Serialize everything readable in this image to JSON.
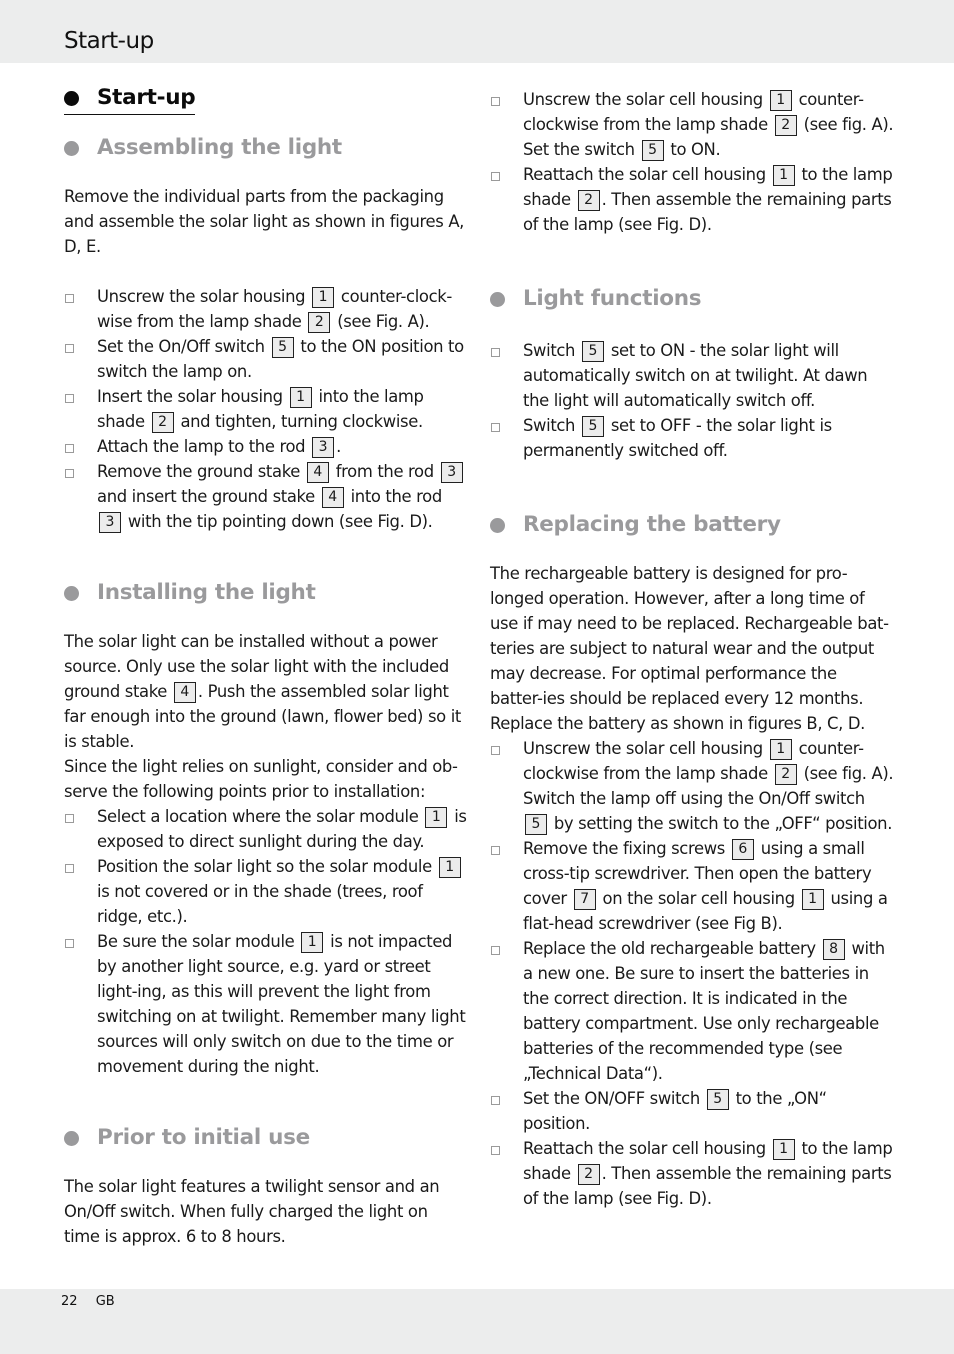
{
  "header": {
    "title": "Start-up"
  },
  "footer": {
    "page_number": "22",
    "language": "GB"
  },
  "main_heading": "Start-up",
  "sections": {
    "assembling": {
      "title": "Assembling the light",
      "intro": "Remove the individual parts from the packaging and assemble the solar light as shown in figures A, D, E.",
      "steps": [
        [
          "Unscrew the solar housing ",
          {
            "ref": "1"
          },
          " counter-clock-wise from the lamp shade ",
          {
            "ref": "2"
          },
          " (see Fig. A)."
        ],
        [
          "Set the On/Off switch ",
          {
            "ref": "5"
          },
          " to the ON position to switch the lamp on."
        ],
        [
          "Insert the solar housing ",
          {
            "ref": "1"
          },
          " into the lamp shade ",
          {
            "ref": "2"
          },
          " and tighten, turning clockwise."
        ],
        [
          "Attach the lamp to the rod ",
          {
            "ref": "3"
          },
          "."
        ],
        [
          "Remove the ground stake ",
          {
            "ref": "4"
          },
          " from the rod ",
          {
            "ref": "3"
          },
          " and insert the ground stake ",
          {
            "ref": "4"
          },
          " into the rod ",
          {
            "ref": "3"
          },
          " with the tip pointing down (see Fig. D)."
        ]
      ]
    },
    "installing": {
      "title": "Installing the light",
      "intro": [
        "The solar light can be installed without a power source. Only use the solar light with the included ground stake ",
        {
          "ref": "4"
        },
        ". Push the assembled solar light far enough into the ground (lawn, flower bed) so it is stable."
      ],
      "intro2": "Since the light relies on sunlight, consider and ob-serve the following points prior to installation:",
      "steps": [
        [
          "Select a location where the solar module ",
          {
            "ref": "1"
          },
          " is exposed to direct sunlight during the day."
        ],
        [
          "Position the solar light so the solar module ",
          {
            "ref": "1"
          },
          " is not covered or in the shade (trees, roof ridge, etc.)."
        ],
        [
          "Be sure the solar module ",
          {
            "ref": "1"
          },
          " is not impacted by another light source, e.g. yard or street light-ing, as this will prevent the light from switching on at twilight. Remember many light sources will only switch on due to the time or movement during the night."
        ]
      ]
    },
    "prior": {
      "title": "Prior to initial use",
      "intro": "The solar light features a twilight sensor and an On/Off switch. When fully charged the light on time is approx. 6 to 8 hours.",
      "steps": [
        [
          "Unscrew the solar cell housing ",
          {
            "ref": "1"
          },
          " counter-clockwise from the lamp shade ",
          {
            "ref": "2"
          },
          " (see fig. A). Set the switch ",
          {
            "ref": "5"
          },
          " to ON."
        ],
        [
          "Reattach the solar cell housing ",
          {
            "ref": "1"
          },
          " to the lamp shade ",
          {
            "ref": "2"
          },
          ". Then assemble the remaining parts of the lamp (see Fig. D)."
        ]
      ]
    },
    "functions": {
      "title": "Light functions",
      "steps": [
        [
          "Switch ",
          {
            "ref": "5"
          },
          " set to ON - the solar light will automatically switch on at twilight. At dawn the light will automatically switch off."
        ],
        [
          "Switch ",
          {
            "ref": "5"
          },
          " set to OFF - the solar light is permanently switched off."
        ]
      ]
    },
    "battery": {
      "title": "Replacing the battery",
      "intro": "The rechargeable battery is designed for pro-longed operation. However, after a long time of use if may need to be replaced. Rechargeable bat-teries are subject to natural wear and the output may decrease. For optimal performance the batter-ies should be replaced every 12 months.",
      "intro2": "Replace the battery as shown in figures B, C, D.",
      "steps": [
        [
          "Unscrew the solar cell housing ",
          {
            "ref": "1"
          },
          " counter-clockwise from the lamp shade ",
          {
            "ref": "2"
          },
          " (see fig. A). Switch the lamp off using the On/Off switch ",
          {
            "ref": "5"
          },
          " by setting the switch to the „OFF“ position."
        ],
        [
          "Remove the fixing screws ",
          {
            "ref": "6"
          },
          " using a small cross-tip screwdriver. Then open the battery cover ",
          {
            "ref": "7"
          },
          " on the solar cell housing ",
          {
            "ref": "1"
          },
          " using a flat-head screwdriver (see Fig B)."
        ],
        [
          "Replace the old rechargeable battery ",
          {
            "ref": "8"
          },
          " with a new one. Be sure to insert the batteries in the correct direction. It is indicated in the battery compartment. Use only rechargeable batteries of the recommended type (see „Technical Data“)."
        ],
        [
          "Set the ON/OFF switch ",
          {
            "ref": "5"
          },
          " to the „ON“ position."
        ],
        [
          "Reattach the solar cell housing ",
          {
            "ref": "1"
          },
          " to the lamp shade ",
          {
            "ref": "2"
          },
          ". Then assemble the remaining parts of the lamp (see Fig. D)."
        ]
      ]
    }
  }
}
